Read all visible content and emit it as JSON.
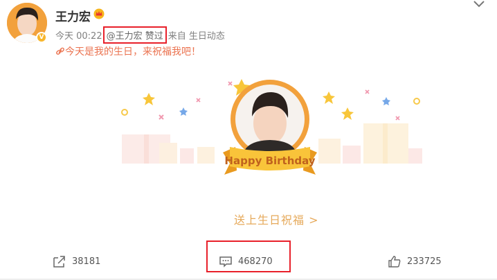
{
  "post": {
    "author": "王力宏",
    "time": "今天 00:22",
    "liked_by": "@王力宏 赞过",
    "source": "来自 生日动态",
    "text": "今天是我的生日，来祝福我吧！",
    "card": {
      "banner_text": "Happy Birthday",
      "cta": "送上生日祝福 >"
    }
  },
  "footer": {
    "repost_count": "38181",
    "comment_count": "468270",
    "like_count": "233725"
  },
  "colors": {
    "accent_orange": "#f2a13c",
    "link_orange": "#eb7350",
    "highlight_red": "#e8202a"
  }
}
